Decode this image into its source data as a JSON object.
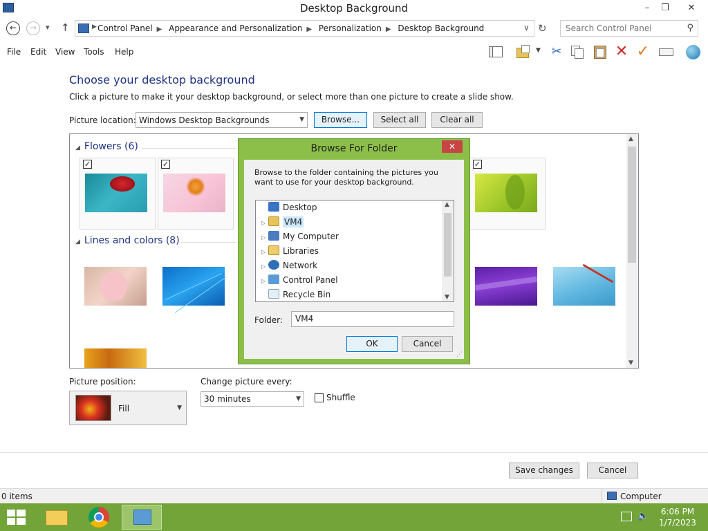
{
  "window": {
    "title": "Desktop Background",
    "minimize": "–",
    "maximize": "❒",
    "close": "✕"
  },
  "nav": {
    "back": "←",
    "forward": "→",
    "recent": "▾",
    "up": "↑",
    "breadcrumbs": [
      "Control Panel",
      "Appearance and Personalization",
      "Personalization",
      "Desktop Background"
    ],
    "refresh": "↻",
    "dropdown": "∨",
    "search_placeholder": "Search Control Panel"
  },
  "menu": {
    "items": [
      "File",
      "Edit",
      "View",
      "Tools",
      "Help"
    ],
    "toolbar_icons": [
      "layout-icon",
      "properties-icon",
      "cut-icon",
      "copy-icon",
      "paste-icon",
      "delete-icon",
      "check-icon",
      "rename-icon",
      "globe-icon"
    ]
  },
  "main": {
    "heading": "Choose your desktop background",
    "description": "Click a picture to make it your desktop background, or select more than one picture to create a slide show.",
    "picture_location_label": "Picture location:",
    "picture_location_value": "Windows Desktop Backgrounds",
    "browse_label": "Browse...",
    "select_all_label": "Select all",
    "clear_all_label": "Clear all"
  },
  "gallery": {
    "groups": [
      {
        "title": "Flowers (6)",
        "checked": true
      },
      {
        "title": "Lines and colors (8)",
        "checked": false
      }
    ],
    "check_mark": "✓"
  },
  "options": {
    "position_label": "Picture position:",
    "position_value": "Fill",
    "interval_label": "Change picture every:",
    "interval_value": "30 minutes",
    "shuffle_label": "Shuffle",
    "shuffle_checked": false
  },
  "footer": {
    "save_label": "Save changes",
    "cancel_label": "Cancel"
  },
  "status": {
    "items_count": "0 items",
    "location": "Computer"
  },
  "taskbar": {
    "time": "6:06 PM",
    "date": "1/7/2023"
  },
  "dialog": {
    "title": "Browse For Folder",
    "close": "✕",
    "instructions": "Browse to the folder containing the pictures you want to use for your desktop background.",
    "tree": [
      {
        "label": "Desktop",
        "icon": "desktop-icon",
        "expandable": false
      },
      {
        "label": "VM4",
        "icon": "user-folder-icon",
        "expandable": true
      },
      {
        "label": "My Computer",
        "icon": "computer-icon",
        "expandable": true
      },
      {
        "label": "Libraries",
        "icon": "libraries-icon",
        "expandable": true
      },
      {
        "label": "Network",
        "icon": "network-icon",
        "expandable": true
      },
      {
        "label": "Control Panel",
        "icon": "control-panel-icon",
        "expandable": true
      },
      {
        "label": "Recycle Bin",
        "icon": "recycle-bin-icon",
        "expandable": false
      }
    ],
    "folder_label": "Folder:",
    "folder_value": "VM4",
    "ok_label": "OK",
    "cancel_label": "Cancel"
  },
  "colors": {
    "heading": "#1e3287",
    "taskbar": "#72a43a",
    "dialog_frame": "#8cbf4a",
    "close_button": "#c74545",
    "selection": "#cce8ff"
  }
}
